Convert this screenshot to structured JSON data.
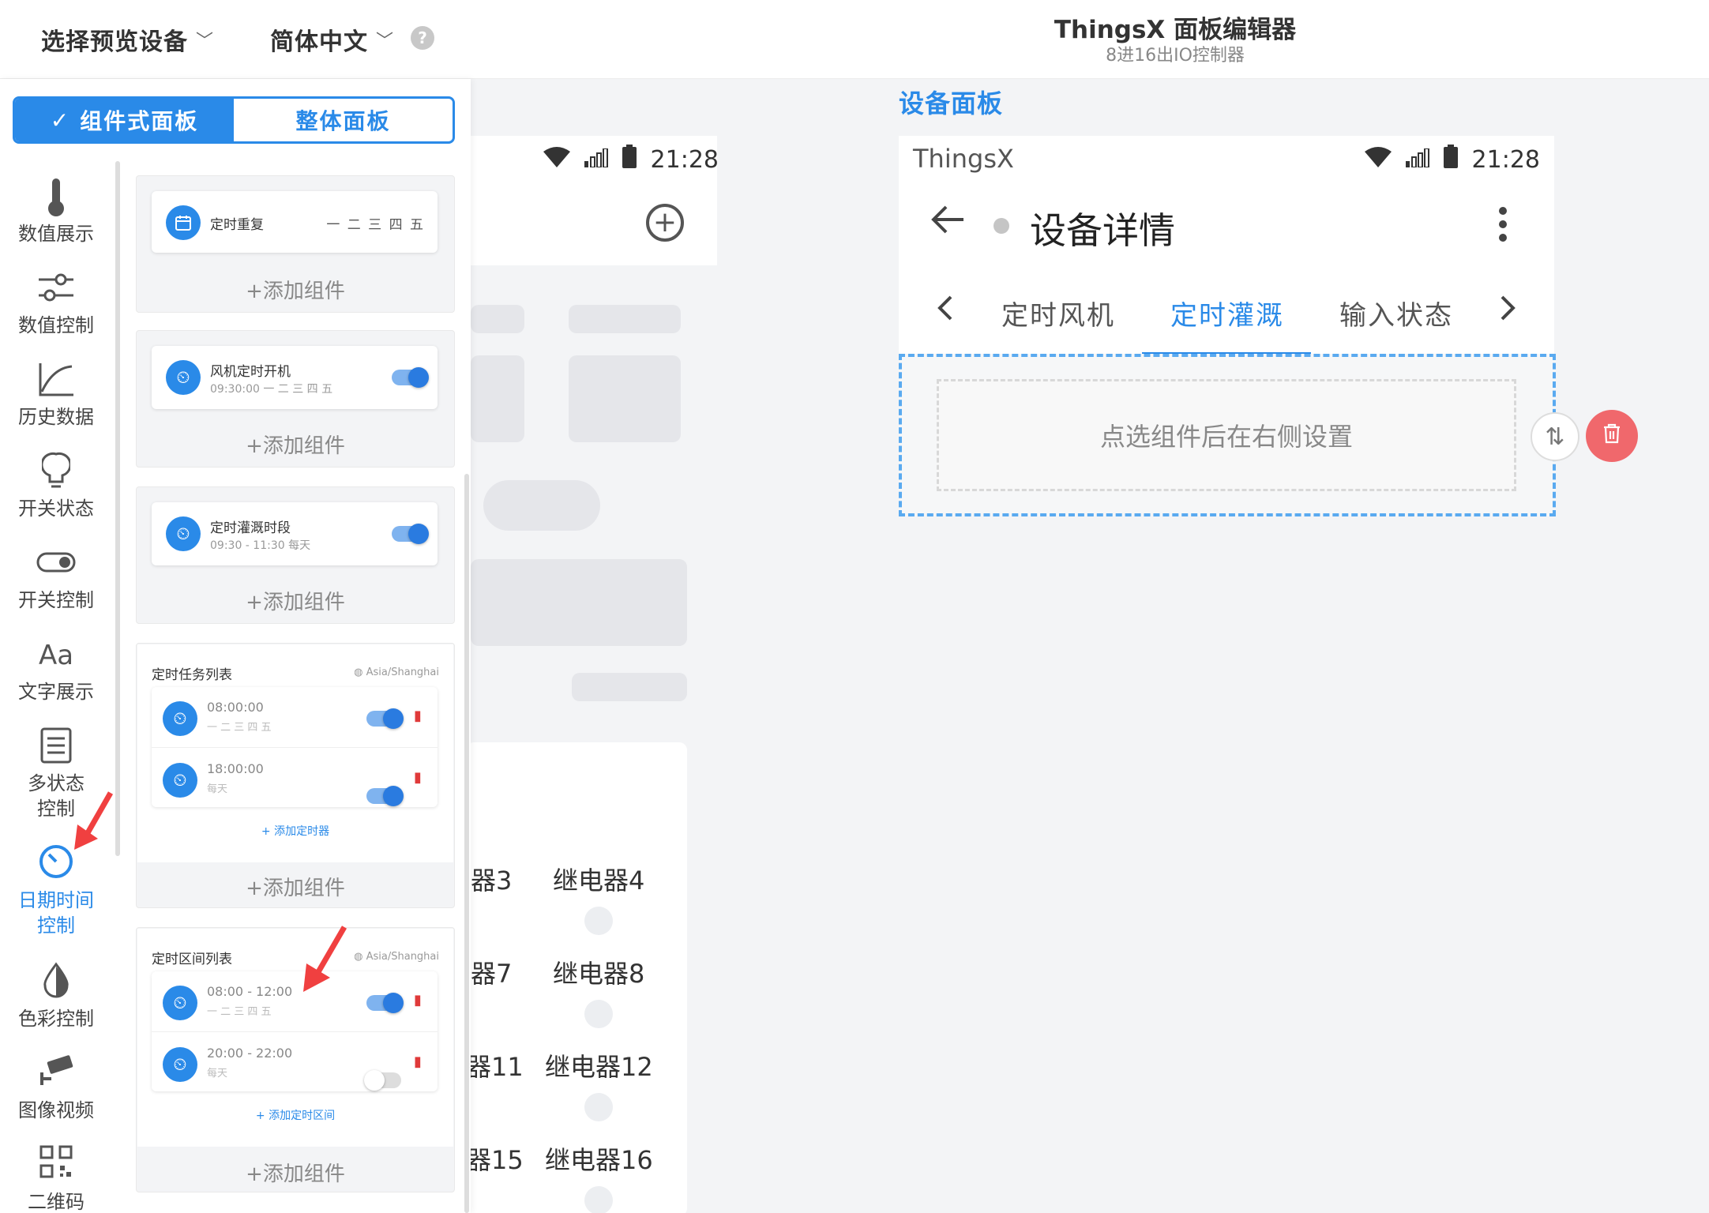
{
  "header": {
    "device_select": "选择预览设备",
    "language": "简体中文",
    "help": "?",
    "title": "ThingsX 面板编辑器",
    "subtitle": "8进16出IO控制器"
  },
  "left_panel": {
    "segment": {
      "component": "组件式面板",
      "whole": "整体面板"
    },
    "categories": [
      "数值展示",
      "数值控制",
      "历史数据",
      "开关状态",
      "开关控制",
      "文字展示",
      "多状态控制",
      "日期时间控制",
      "色彩控制",
      "图像视频",
      "二维码"
    ],
    "groups": {
      "add_component": "+添加组件",
      "timer_repeat": {
        "title": "定时重复",
        "days": "一 二 三 四 五"
      },
      "fan_timer": {
        "title": "风机定时开机",
        "sub": "09:30:00 一 二 三 四 五"
      },
      "irrigation_period": {
        "title": "定时灌溉时段",
        "sub": "09:30 - 11:30 每天"
      },
      "task_list": {
        "title": "定时任务列表",
        "tz": "Asia/Shanghai",
        "items": [
          {
            "time": "08:00:00",
            "days": "一 二 三 四 五"
          },
          {
            "time": "18:00:00",
            "days": "每天"
          }
        ],
        "add": "+ 添加定时器"
      },
      "range_list": {
        "title": "定时区间列表",
        "tz": "Asia/Shanghai",
        "items": [
          {
            "time": "08:00 - 12:00",
            "days": "一 二 三 四 五"
          },
          {
            "time": "20:00 - 22:00",
            "days": "每天"
          }
        ],
        "add": "+ 添加定时区间"
      }
    }
  },
  "preview_phone": {
    "time": "21:28",
    "relays": [
      [
        "器3",
        "继电器4"
      ],
      [
        "器7",
        "继电器8"
      ],
      [
        "器11",
        "继电器12"
      ],
      [
        "器15",
        "继电器16"
      ]
    ]
  },
  "device_panel": {
    "label": "设备面板",
    "brand": "ThingsX",
    "time": "21:28",
    "title": "设备详情",
    "tabs": [
      "定时风机",
      "定时灌溉",
      "输入状态"
    ],
    "active_tab": "定时灌溉",
    "placeholder": "点选组件后在右侧设置"
  },
  "colors": {
    "accent": "#2a8ae8",
    "danger": "#f0686c"
  }
}
